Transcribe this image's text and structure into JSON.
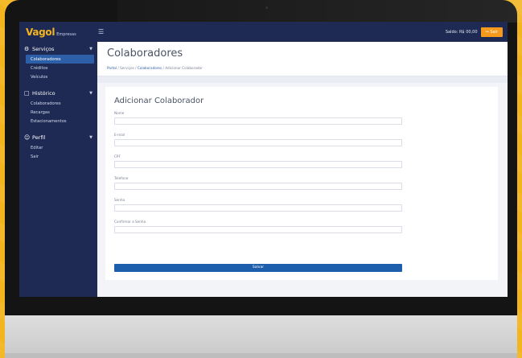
{
  "topbar": {
    "brand_main": "Vagol",
    "brand_sub": "Empresas",
    "saldo": "Saldo: R$ 00,00",
    "sair_label": "Sair"
  },
  "sidebar": {
    "sections": [
      {
        "title": "Serviços",
        "icon": "gear-icon",
        "items": [
          "Colaboradores",
          "Créditos",
          "Veículos"
        ]
      },
      {
        "title": "Histórico",
        "icon": "folder-icon",
        "items": [
          "Colaboradores",
          "Recargas",
          "Estacionamentos"
        ]
      },
      {
        "title": "Perfil",
        "icon": "user-icon",
        "items": [
          "Editar",
          "Sair"
        ]
      }
    ]
  },
  "header": {
    "title": "Colaboradores",
    "breadcrumb": [
      "Portal",
      "Serviços",
      "Colaboradores",
      "Adicionar Colaborador"
    ]
  },
  "form": {
    "title": "Adicionar Colaborador",
    "fields": [
      {
        "label": "Nome",
        "value": ""
      },
      {
        "label": "E-mail",
        "value": ""
      },
      {
        "label": "CPF",
        "value": ""
      },
      {
        "label": "Telefone",
        "value": ""
      },
      {
        "label": "Senha",
        "value": ""
      },
      {
        "label": "Confirmar a Senha",
        "value": ""
      }
    ],
    "submit_label": "Salvar"
  },
  "colors": {
    "background": "#f2b51e",
    "navy": "#1e2a54",
    "accent": "#f59a1c",
    "primary": "#1d5fad"
  }
}
